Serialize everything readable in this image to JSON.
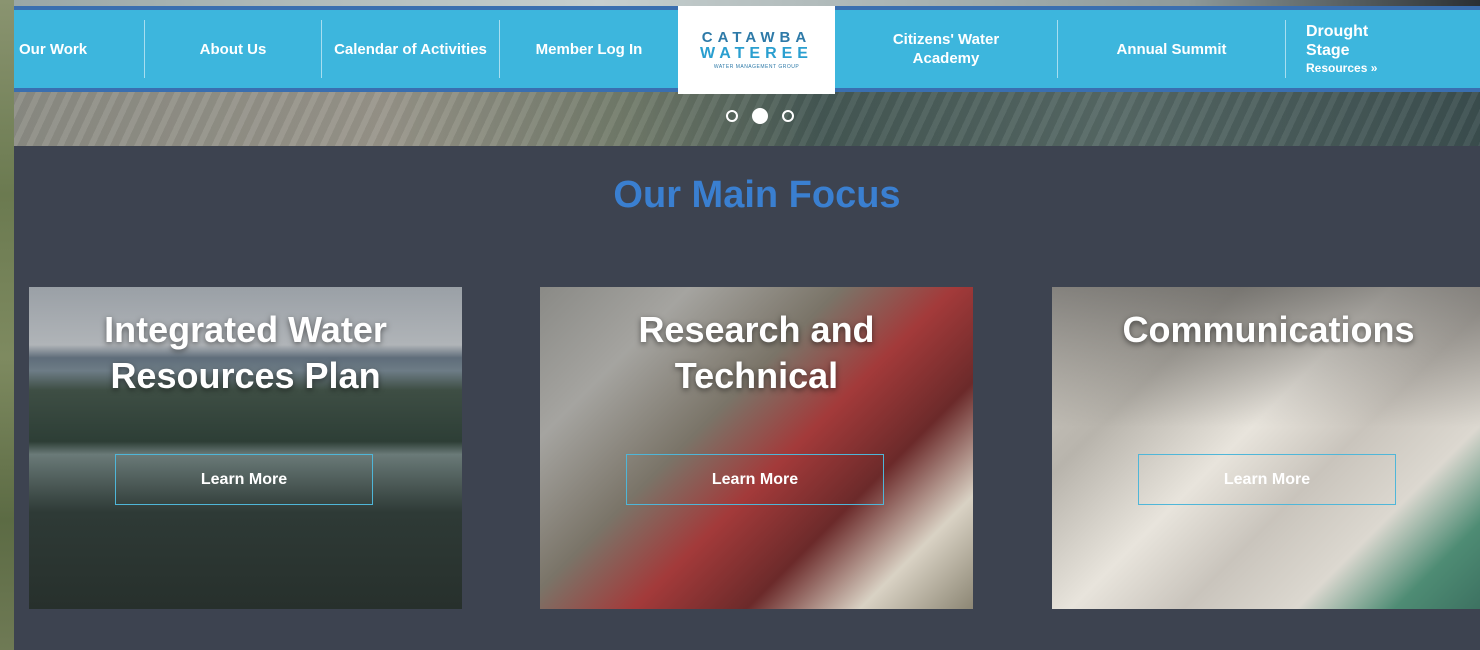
{
  "nav": {
    "items": [
      {
        "label": "Our Work"
      },
      {
        "label": "About Us"
      },
      {
        "label": "Calendar of Activities"
      },
      {
        "label": "Member Log In"
      },
      {
        "label": "Citizens' Water Academy"
      },
      {
        "label": "Annual Summit"
      }
    ],
    "drought": {
      "line1": "Drought",
      "line2": "Stage",
      "line3": "Resources »"
    }
  },
  "logo": {
    "line1": "CATAWBA",
    "line2": "WATEREE",
    "line3": "WATER MANAGEMENT GROUP"
  },
  "slider": {
    "slide_count": 3,
    "active_index": 1
  },
  "focus": {
    "title": "Our Main Focus",
    "cards": [
      {
        "title": "Integrated Water Resources Plan",
        "button": "Learn More"
      },
      {
        "title": "Research and Technical",
        "button": "Learn More"
      },
      {
        "title": "Communications",
        "button": "Learn More"
      }
    ]
  }
}
